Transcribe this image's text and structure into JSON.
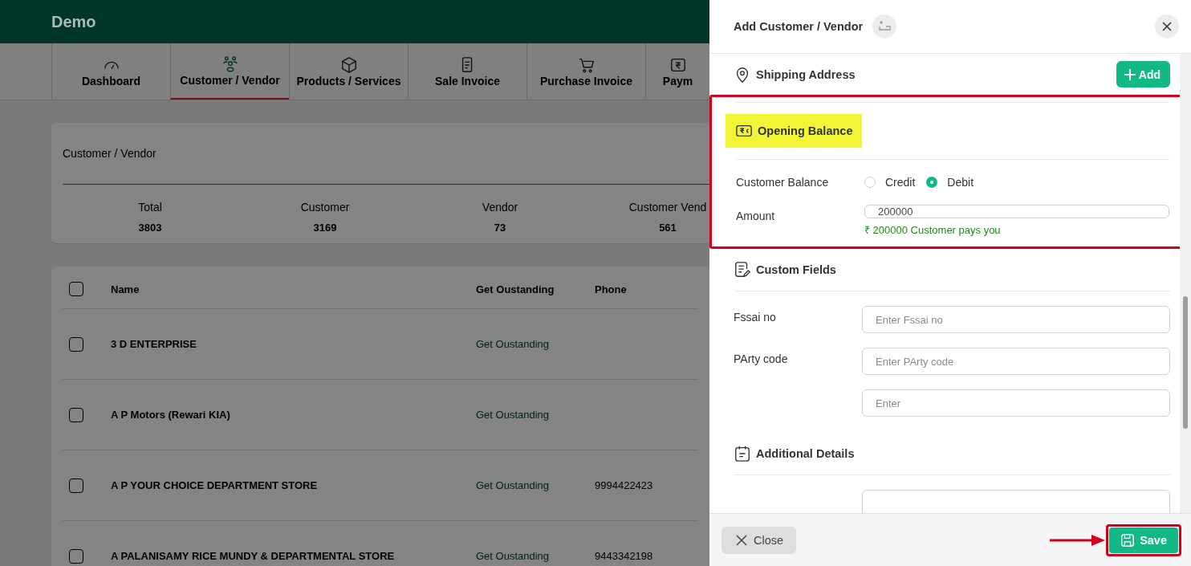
{
  "app": {
    "title": "Demo"
  },
  "tabs": [
    {
      "label": "Dashboard",
      "selected": false
    },
    {
      "label": "Customer / Vendor",
      "selected": true
    },
    {
      "label": "Products / Services",
      "selected": false
    },
    {
      "label": "Sale Invoice",
      "selected": false
    },
    {
      "label": "Purchase Invoice",
      "selected": false
    },
    {
      "label": "Paym",
      "selected": false
    }
  ],
  "summary": {
    "title": "Customer / Vendor",
    "stats": [
      {
        "label": "Total",
        "value": "3803"
      },
      {
        "label": "Customer",
        "value": "3169"
      },
      {
        "label": "Vendor",
        "value": "73"
      },
      {
        "label": "Customer Vend",
        "value": "561"
      }
    ]
  },
  "table": {
    "select_all_checked": false,
    "columns": [
      "Name",
      "Get Oustanding",
      "Phone"
    ],
    "rows": [
      {
        "checked": false,
        "name": "3 D ENTERPRISE",
        "link": "Get Oustanding"
      },
      {
        "checked": false,
        "name": "A P Motors (Rewari KIA)",
        "link": "Get Oustanding"
      },
      {
        "checked": false,
        "name": "A P YOUR CHOICE DEPARTMENT STORE",
        "link": "Get Oustanding",
        "phone": "9994422423"
      },
      {
        "checked": false,
        "name": "A PALANISAMY RICE MUNDY & DEPARTMENTAL STORE",
        "link": "Get Oustanding",
        "phone": "9443342198"
      }
    ]
  },
  "drawer": {
    "title": "Add Customer / Vendor",
    "shipping": {
      "title": "Shipping Address",
      "add_button": "Add"
    },
    "opening_balance": {
      "title": "Opening Balance",
      "title_highlighted": true,
      "framed": true,
      "balance_label": "Customer Balance",
      "options": [
        {
          "label": "Credit",
          "selected": false
        },
        {
          "label": "Debit",
          "selected": true
        }
      ],
      "amount_label": "Amount",
      "amount_value": "200000",
      "hint": "₹ 200000 Customer pays you"
    },
    "custom_fields": {
      "title": "Custom Fields",
      "fields": [
        {
          "label": "Fssai no",
          "placeholder": "Enter Fssai no"
        },
        {
          "label": "PArty code",
          "placeholder": "Enter PArty code"
        },
        {
          "placeholder": "Enter"
        }
      ]
    },
    "additional": {
      "title": "Additional Details"
    },
    "close_button": "Close",
    "save_button": "Save",
    "save_annotated": true
  }
}
